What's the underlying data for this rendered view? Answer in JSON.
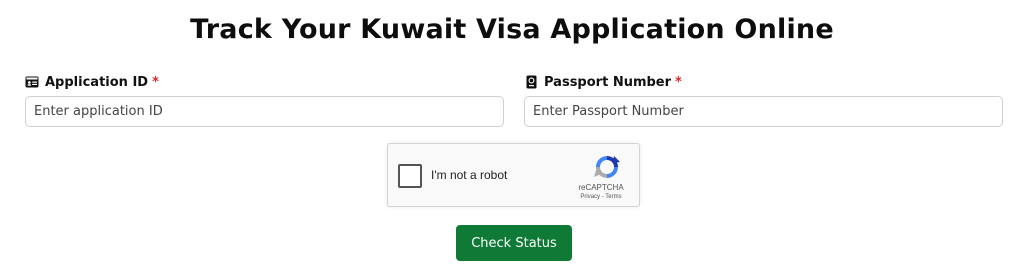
{
  "page": {
    "title": "Track Your Kuwait Visa Application Online"
  },
  "form": {
    "application_id": {
      "label": "Application ID",
      "required_mark": "*",
      "icon": "id-card-icon",
      "placeholder": "Enter application ID",
      "value": ""
    },
    "passport_number": {
      "label": "Passport Number",
      "required_mark": "*",
      "icon": "passport-icon",
      "placeholder": "Enter Passport Number",
      "value": ""
    },
    "captcha": {
      "label": "I'm not a robot",
      "brand": "reCAPTCHA",
      "links": "Privacy - Terms",
      "icon": "recaptcha-logo-icon",
      "checked": false
    },
    "submit_label": "Check Status"
  },
  "colors": {
    "button_bg": "#0e7a36",
    "required": "#e0262b",
    "input_border": "#cfcfcf"
  }
}
